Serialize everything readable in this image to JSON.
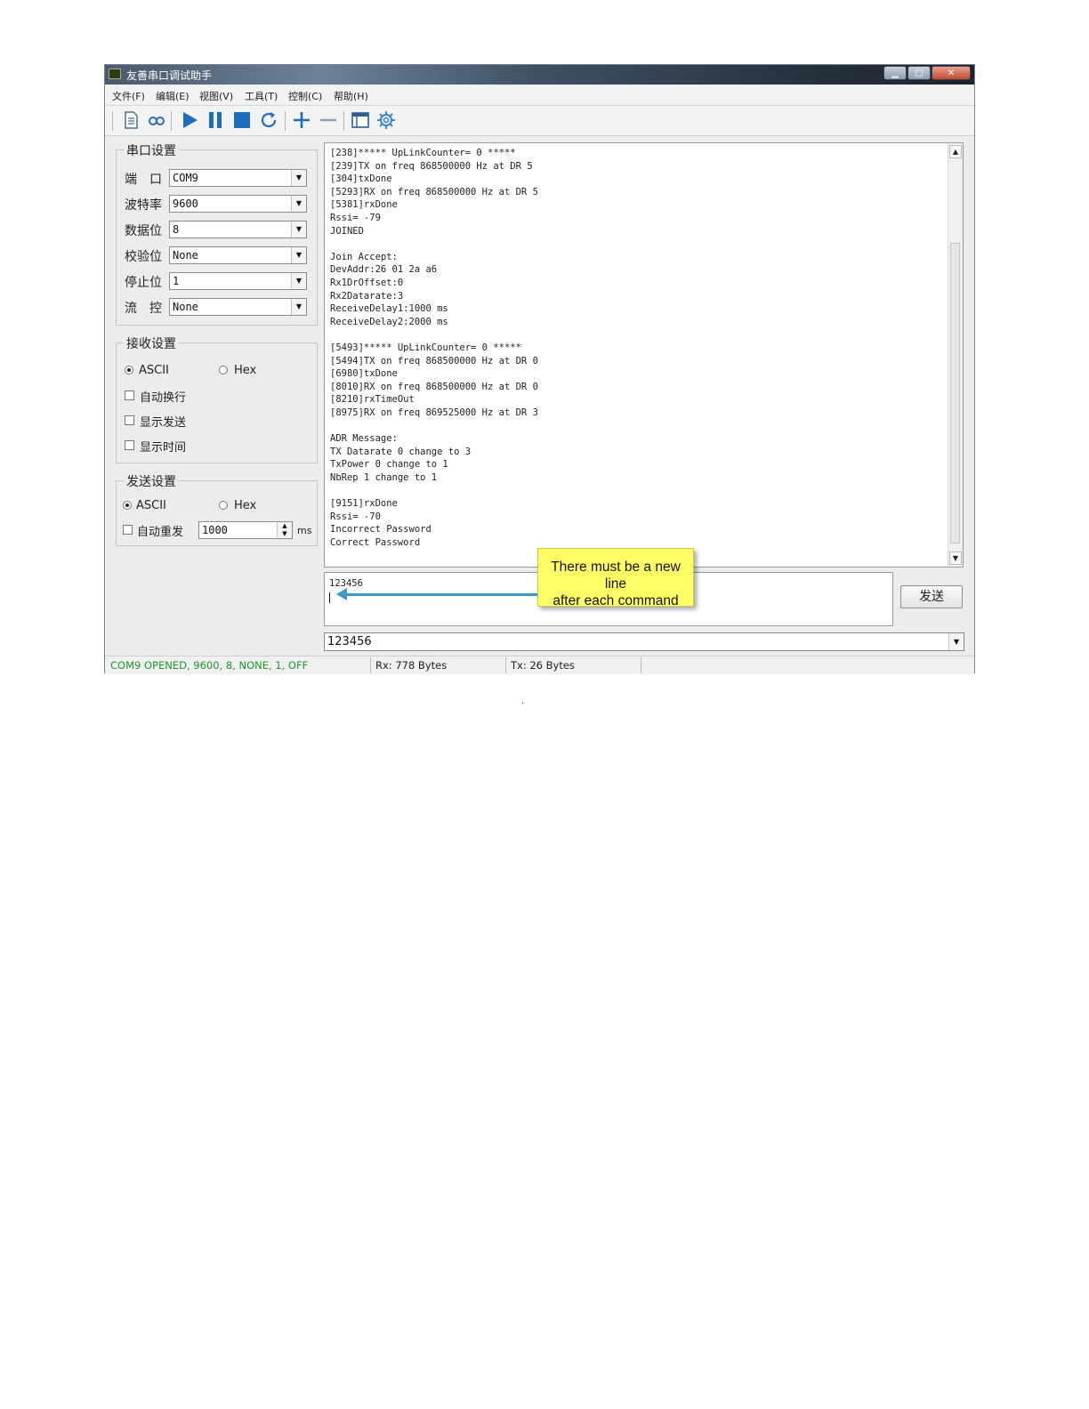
{
  "window": {
    "title": "友善串口调试助手"
  },
  "menu": [
    "文件(F)",
    "编辑(E)",
    "视图(V)",
    "工具(T)",
    "控制(C)",
    "帮助(H)"
  ],
  "toolbar_icons": [
    "new-document-icon",
    "loop-icon",
    "play-icon",
    "pause-icon",
    "stop-icon",
    "refresh-icon",
    "plus-icon",
    "minus-icon",
    "window-icon",
    "gear-icon"
  ],
  "serial_settings": {
    "title": "串口设置",
    "rows": [
      {
        "label": "端　口",
        "value": "COM9"
      },
      {
        "label": "波特率",
        "value": "9600"
      },
      {
        "label": "数据位",
        "value": "8"
      },
      {
        "label": "校验位",
        "value": "None"
      },
      {
        "label": "停止位",
        "value": "1"
      },
      {
        "label": "流　控",
        "value": "None"
      }
    ]
  },
  "receive_settings": {
    "title": "接收设置",
    "ascii": "ASCII",
    "hex": "Hex",
    "options": [
      "自动换行",
      "显示发送",
      "显示时间"
    ]
  },
  "send_settings": {
    "title": "发送设置",
    "ascii": "ASCII",
    "hex": "Hex",
    "auto_resend": "自动重发",
    "interval": "1000",
    "unit": "ms"
  },
  "output_lines": [
    "[238]***** UpLinkCounter= 0 *****",
    "[239]TX on freq 868500000 Hz at DR 5",
    "[304]txDone",
    "[5293]RX on freq 868500000 Hz at DR 5",
    "[5381]rxDone",
    "Rssi= -79",
    "JOINED",
    "",
    "Join Accept:",
    "DevAddr:26 01 2a a6",
    "Rx1DrOffset:0",
    "Rx2Datarate:3",
    "ReceiveDelay1:1000 ms",
    "ReceiveDelay2:2000 ms",
    "",
    "[5493]***** UpLinkCounter= 0 *****",
    "[5494]TX on freq 868500000 Hz at DR 0",
    "[6980]txDone",
    "[8010]RX on freq 868500000 Hz at DR 0",
    "[8210]rxTimeOut",
    "[8975]RX on freq 869525000 Hz at DR 3",
    "",
    "ADR Message:",
    "TX Datarate 0 change to 3",
    "TxPower 0 change to 1",
    "NbRep 1 change to 1",
    "",
    "[9151]rxDone",
    "Rssi= -70",
    "Incorrect Password",
    "Correct Password"
  ],
  "input_text": "123456",
  "send_button": "发送",
  "history_value": "123456",
  "status": {
    "port": "COM9 OPENED, 9600, 8, NONE, 1, OFF",
    "rx": "Rx: 778 Bytes",
    "tx": "Tx: 26 Bytes",
    "port_color": "#1e9a2a"
  },
  "callout": {
    "line1": "There  must be a new line",
    "line2": "after each command"
  },
  "footer_dot": "."
}
